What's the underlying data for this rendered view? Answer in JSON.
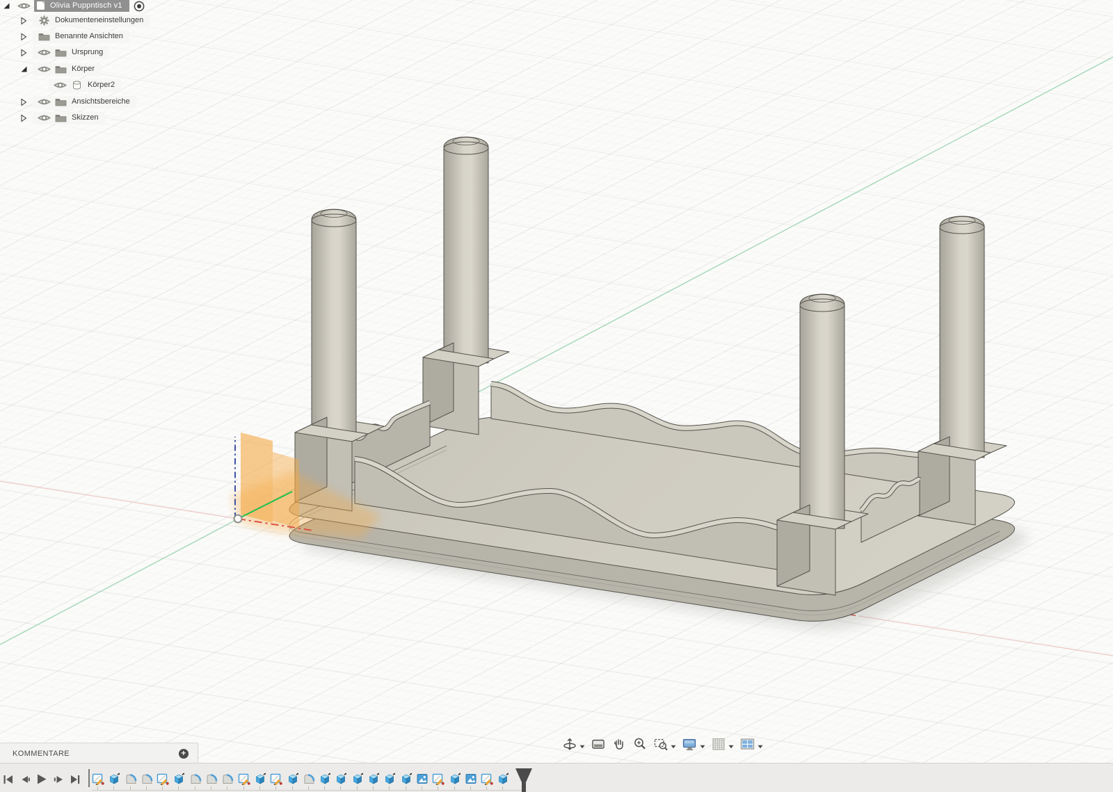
{
  "browser": {
    "root": {
      "label": "Olivia Puppntisch v1",
      "marker": "expanded-triangle-icon",
      "icons": [
        "eye-icon",
        "document-icon",
        "activate-radio-icon"
      ]
    },
    "items": [
      {
        "label": "Dokumenteneinstellungen",
        "icon": "gear",
        "arrow": "collapsed",
        "eye": false,
        "indent": 0
      },
      {
        "label": "Benannte Ansichten",
        "icon": "folder",
        "arrow": "collapsed",
        "eye": false,
        "indent": 0
      },
      {
        "label": "Ursprung",
        "icon": "folder",
        "arrow": "collapsed",
        "eye": true,
        "indent": 0
      },
      {
        "label": "Körper",
        "icon": "folder",
        "arrow": "expanded",
        "eye": true,
        "indent": 0
      },
      {
        "label": "Körper2",
        "icon": "body-cylinder",
        "arrow": "none",
        "eye": true,
        "indent": 1
      },
      {
        "label": "Ansichtsbereiche",
        "icon": "folder",
        "arrow": "collapsed",
        "eye": true,
        "indent": 0
      },
      {
        "label": "Skizzen",
        "icon": "folder",
        "arrow": "collapsed",
        "eye": true,
        "indent": 0
      }
    ]
  },
  "comments": {
    "label": "KOMMENTARE",
    "add_icon": "plus-circle-icon"
  },
  "timeline": {
    "playback": [
      "skip-start",
      "step-back",
      "play",
      "step-forward",
      "skip-end"
    ],
    "features": [
      "sketch",
      "extrude",
      "fillet",
      "fillet",
      "sketch",
      "extrude",
      "fillet",
      "fillet",
      "fillet",
      "sketch",
      "extrude",
      "sketch",
      "extrude",
      "fillet",
      "extrude",
      "extrude",
      "extrude",
      "extrude",
      "extrude",
      "extrude",
      "canvas",
      "sketch",
      "extrude",
      "canvas",
      "sketch",
      "extrude"
    ]
  },
  "nav_toolbar": {
    "items": [
      {
        "name": "orbit",
        "caret": true
      },
      {
        "name": "look-at",
        "caret": false
      },
      {
        "name": "pan",
        "caret": false
      },
      {
        "name": "zoom",
        "caret": false
      },
      {
        "name": "fit",
        "caret": true
      },
      {
        "name": "display-settings",
        "caret": true
      },
      {
        "name": "grid-display",
        "caret": true
      },
      {
        "name": "viewports",
        "caret": true
      }
    ]
  },
  "viewport": {
    "axis_colors": {
      "x": "#dd4a3c",
      "y": "#22c053",
      "z": "#3f51a5"
    },
    "axis_faint_colors": {
      "x": "#ecc8c4",
      "y": "#9fd6b4"
    },
    "highlight_color": "#f3a842",
    "model_color": "#cbc8bd"
  }
}
